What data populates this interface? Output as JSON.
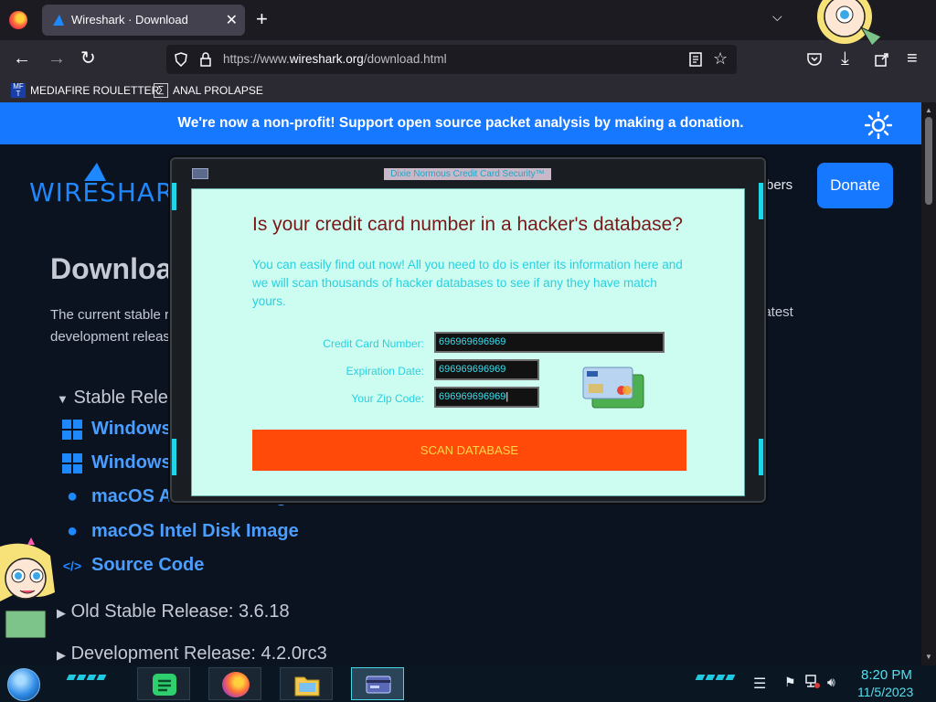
{
  "browser": {
    "tab_title": "Wireshark · Download",
    "url_prefix": "https://www.",
    "url_domain": "wireshark.org",
    "url_path": "/download.html",
    "bookmarks": [
      {
        "icon": "mediafire-icon",
        "badge": "MF T",
        "label": "MEDIAFIRE ROULETTER"
      },
      {
        "icon": "bookmark-icon",
        "label": "ANAL PROLAPSE"
      }
    ]
  },
  "page": {
    "banner": "We're now a non-profit! Support open source packet analysis by making a donation.",
    "logo": "WIRESHARK",
    "nav_members_fragment": "bers",
    "donate_label": "Donate",
    "heading_fragment": "Downloa",
    "intro_left": "The current stable r",
    "intro_left_2": "development releas",
    "intro_right": "latest",
    "stable_release_fragment": "Stable Relea",
    "downloads": [
      {
        "icon": "windows-icon",
        "label": "Windows"
      },
      {
        "icon": "windows-icon",
        "label": "Windows"
      },
      {
        "icon": "apple-icon",
        "label": "macOS Arm Disk Image"
      },
      {
        "icon": "apple-icon",
        "label": "macOS Intel Disk Image"
      },
      {
        "icon": "code-icon",
        "label": "Source Code"
      }
    ],
    "old_stable": "Old Stable Release: 3.6.18",
    "dev_release": "Development Release: 4.2.0rc3"
  },
  "popup": {
    "window_title": "Dixie Normous Credit Card Security™",
    "question": "Is your credit card number in a hacker's database?",
    "description": "You can easily find out now! All you need to do is enter its information here and we will scan thousands of hacker databases to see if any they have match yours.",
    "fields": {
      "card_label": "Credit Card Number:",
      "card_value": "696969696969",
      "exp_label": "Expiration Date:",
      "exp_value": "696969696969",
      "zip_label": "Your Zip Code:",
      "zip_value": "696969696969"
    },
    "scan_label": "SCAN DATABASE"
  },
  "taskbar": {
    "apps": [
      "notes-icon",
      "firefox-icon",
      "folder-icon",
      "credit-card-app-icon"
    ],
    "time": "8:20 PM",
    "date": "11/5/2023"
  },
  "colors": {
    "accent": "#1677ff",
    "popup_bg": "#ccfdf0",
    "scan_button": "#ff4a0a",
    "question_text": "#7a1818",
    "cyan_text": "#2ad0e0"
  }
}
